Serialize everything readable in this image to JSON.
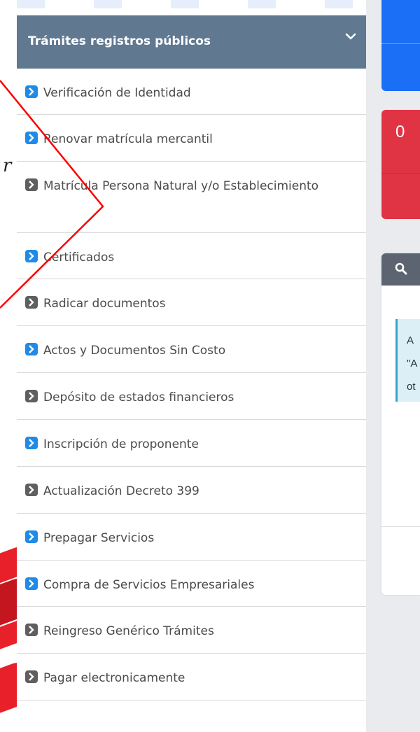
{
  "menu": {
    "title": "Trámites registros públicos",
    "items": [
      {
        "label": "Verificación de Identidad",
        "icon": "blue"
      },
      {
        "label": "Renovar matrícula mercantil",
        "icon": "blue"
      },
      {
        "label": "Matrícula Persona Natural y/o Establecimiento",
        "icon": "gray"
      },
      {
        "label": "Certificados",
        "icon": "blue"
      },
      {
        "label": "Radicar documentos",
        "icon": "gray"
      },
      {
        "label": "Actos y Documentos Sin Costo",
        "icon": "blue"
      },
      {
        "label": "Depósito de estados financieros",
        "icon": "gray"
      },
      {
        "label": "Inscripción de proponente",
        "icon": "blue"
      },
      {
        "label": "Actualización Decreto 399",
        "icon": "gray"
      },
      {
        "label": "Prepagar Servicios",
        "icon": "blue"
      },
      {
        "label": "Compra de Servicios Empresariales",
        "icon": "blue"
      },
      {
        "label": "Reingreso Genérico Trámites",
        "icon": "gray"
      },
      {
        "label": "Pagar electronicamente",
        "icon": "gray"
      }
    ]
  },
  "right": {
    "counter": "0",
    "alert_text": "A\n\"A\not"
  },
  "background": {
    "mark": "r"
  },
  "colors": {
    "header_bg": "#607890",
    "blue_icon": "#1f8be6",
    "gray_icon": "#5f5f5f",
    "accent_blue": "#1b6ef6",
    "accent_red": "#e03444",
    "annotation": "#ff0000"
  }
}
